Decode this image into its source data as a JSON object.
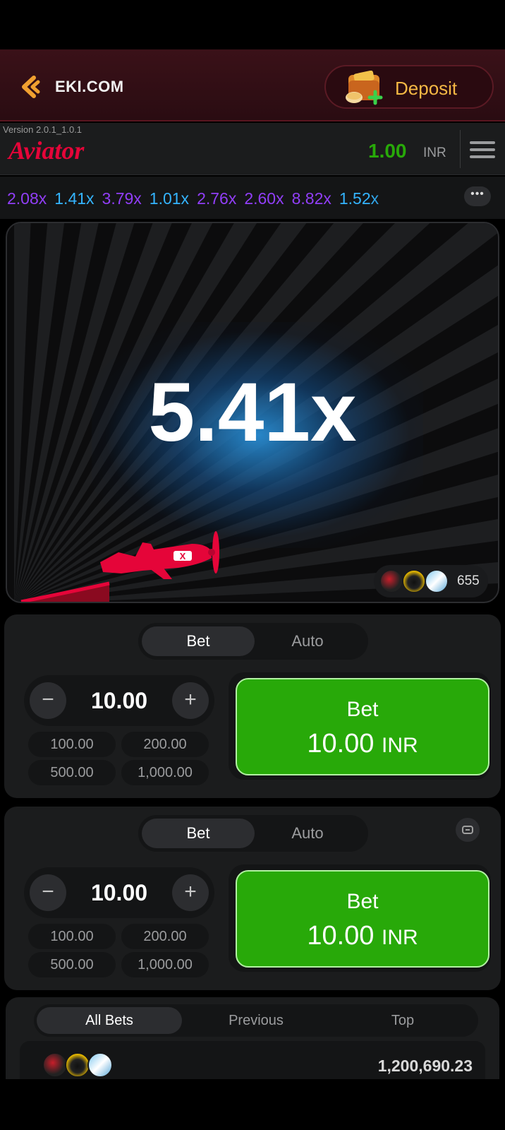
{
  "header": {
    "brand": "EKI.COM",
    "deposit_label": "Deposit"
  },
  "game_bar": {
    "version": "Version 2.0.1_1.0.1",
    "logo": "Aviator",
    "balance": "1.00",
    "currency": "INR"
  },
  "history": [
    {
      "value": "2.08x",
      "color": "#913ef8"
    },
    {
      "value": "1.41x",
      "color": "#34b4ff"
    },
    {
      "value": "3.79x",
      "color": "#913ef8"
    },
    {
      "value": "1.01x",
      "color": "#34b4ff"
    },
    {
      "value": "2.76x",
      "color": "#913ef8"
    },
    {
      "value": "2.60x",
      "color": "#913ef8"
    },
    {
      "value": "8.82x",
      "color": "#913ef8"
    },
    {
      "value": "1.52x",
      "color": "#34b4ff"
    }
  ],
  "stage": {
    "multiplier": "5.41x",
    "players_count": "655"
  },
  "panels": [
    {
      "tab_bet": "Bet",
      "tab_auto": "Auto",
      "amount": "10.00",
      "quick": [
        "100.00",
        "200.00",
        "500.00",
        "1,000.00"
      ],
      "bet_label": "Bet",
      "bet_amount": "10.00",
      "bet_currency": "INR"
    },
    {
      "tab_bet": "Bet",
      "tab_auto": "Auto",
      "amount": "10.00",
      "quick": [
        "100.00",
        "200.00",
        "500.00",
        "1,000.00"
      ],
      "bet_label": "Bet",
      "bet_amount": "10.00",
      "bet_currency": "INR"
    }
  ],
  "bets": {
    "tabs": [
      "All Bets",
      "Previous",
      "Top"
    ],
    "total": "1,200,690.23"
  },
  "icons": {
    "back": "chevron-left-icon",
    "wallet": "wallet-icon",
    "menu": "hamburger-menu-icon",
    "more": "more-dots-icon",
    "plane": "airplane-icon",
    "collapse": "collapse-panel-icon"
  },
  "colors": {
    "accent_green": "#28a909",
    "brand_red": "#e50539",
    "deposit_gold": "#f5b844"
  }
}
